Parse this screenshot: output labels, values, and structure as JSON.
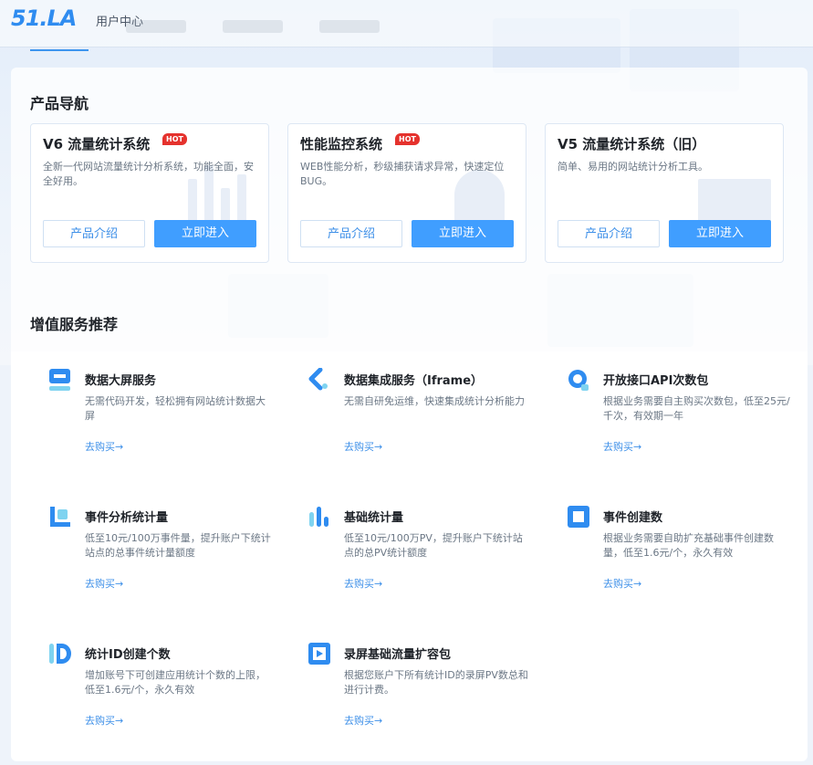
{
  "header": {
    "logo": "51.LA",
    "subtitle": "用户中心"
  },
  "products_section": {
    "title": "产品导航",
    "cards": [
      {
        "title": "V6 流量统计系统",
        "hot": "HOT",
        "desc": "全新一代网站流量统计分析系统，功能全面，安全好用。",
        "intro_label": "产品介绍",
        "enter_label": "立即进入"
      },
      {
        "title": "性能监控系统",
        "hot": "HOT",
        "desc": "WEB性能分析，秒级捕获请求异常，快速定位BUG。",
        "intro_label": "产品介绍",
        "enter_label": "立即进入"
      },
      {
        "title": "V5 流量统计系统（旧）",
        "hot": "",
        "desc": "简单、易用的网站统计分析工具。",
        "intro_label": "产品介绍",
        "enter_label": "立即进入"
      }
    ]
  },
  "services_section": {
    "title": "增值服务推荐",
    "items": [
      {
        "title": "数据大屏服务",
        "desc": "无需代码开发，轻松拥有网站统计数据大屏",
        "link": "去购买→",
        "icon": "screen-icon"
      },
      {
        "title": "数据集成服务（Iframe）",
        "desc": "无需自研免运维，快速集成统计分析能力",
        "link": "去购买→",
        "icon": "integration-icon"
      },
      {
        "title": "开放接口API次数包",
        "desc": "根据业务需要自主购买次数包，低至25元/千次，有效期一年",
        "link": "去购买→",
        "icon": "api-icon"
      },
      {
        "title": "事件分析统计量",
        "desc": "低至10元/100万事件量，提升账户下统计站点的总事件统计量额度",
        "link": "去购买→",
        "icon": "event-analysis-icon"
      },
      {
        "title": "基础统计量",
        "desc": "低至10元/100万PV，提升账户下统计站点的总PV统计额度",
        "link": "去购买→",
        "icon": "bar-chart-icon"
      },
      {
        "title": "事件创建数",
        "desc": "根据业务需要自助扩充基础事件创建数量，低至1.6元/个，永久有效",
        "link": "去购买→",
        "icon": "event-create-icon"
      },
      {
        "title": "统计ID创建个数",
        "desc": "增加账号下可创建应用统计个数的上限，低至1.6元/个，永久有效",
        "link": "去购买→",
        "icon": "id-icon"
      },
      {
        "title": "录屏基础流量扩容包",
        "desc": "根据您账户下所有统计ID的录屏PV数总和进行计费。",
        "link": "去购买→",
        "icon": "recording-icon"
      }
    ]
  },
  "colors": {
    "accent": "#409eff",
    "link": "#3d8fe8",
    "hot": "#e5322d"
  }
}
